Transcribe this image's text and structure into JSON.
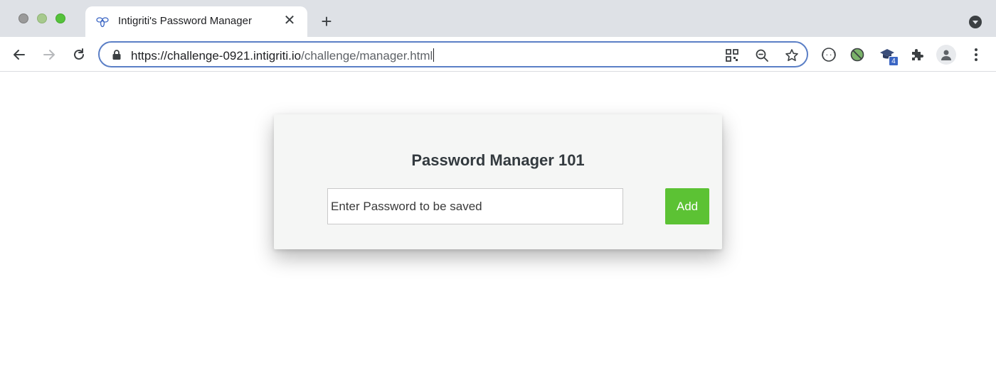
{
  "browser": {
    "tab": {
      "title": "Intigriti's Password Manager",
      "close_glyph": "✕",
      "favicon": "bee-logo-icon"
    },
    "new_tab_glyph": "+",
    "omnibox": {
      "host": "https://challenge-0921.intigriti.io",
      "path": "/challenge/manager.html"
    },
    "extension_badge": "4",
    "colors": {
      "focus_ring": "#5b7fc6",
      "tabstrip": "#dee1e6"
    }
  },
  "page": {
    "title": "Password Manager 101",
    "password_input": {
      "placeholder": "Enter Password to be saved",
      "value": ""
    },
    "add_button_label": "Add",
    "colors": {
      "add_button": "#5cc234",
      "card_bg": "#f5f6f5"
    }
  }
}
